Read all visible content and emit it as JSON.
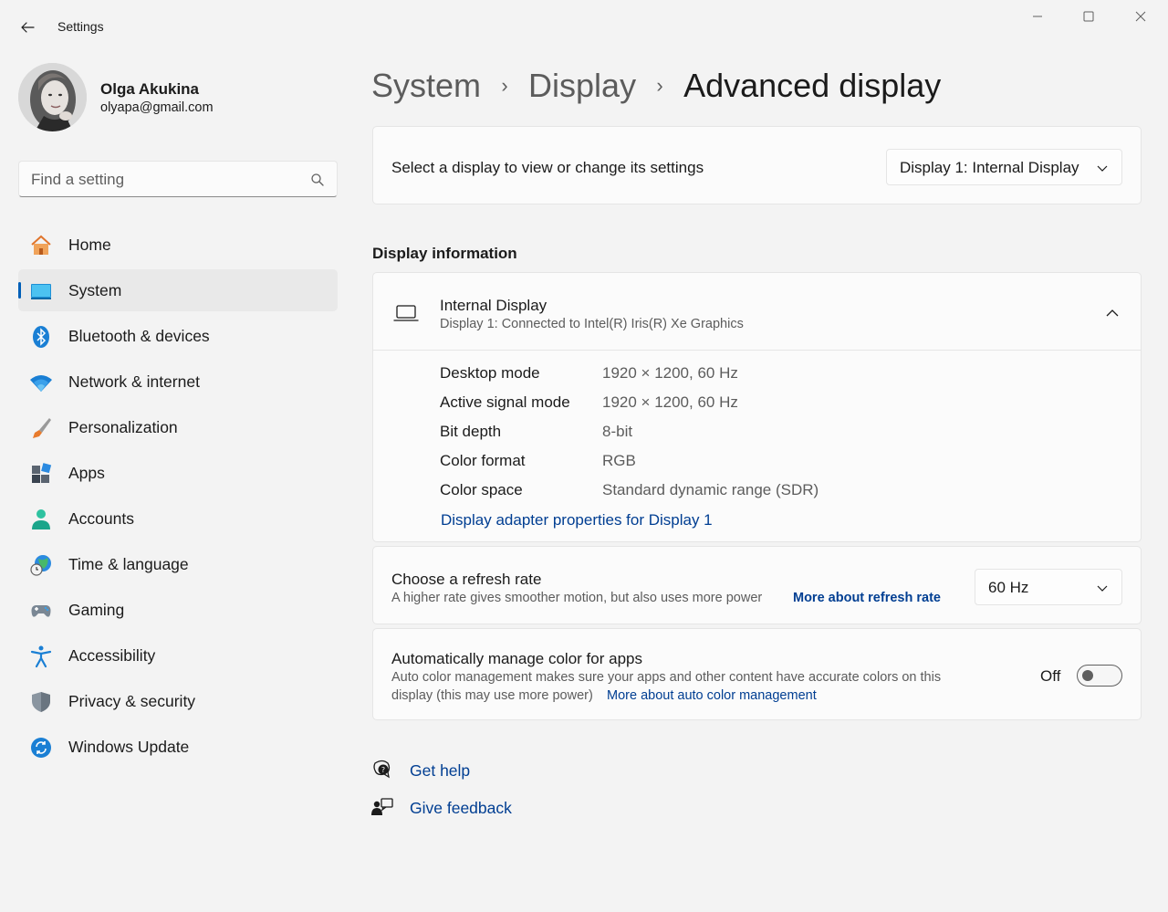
{
  "window": {
    "title": "Settings",
    "back_icon": "back-arrow-icon",
    "controls": [
      "minimize-icon",
      "maximize-icon",
      "close-icon"
    ]
  },
  "profile": {
    "name": "Olga Akukina",
    "email": "olyapa@gmail.com"
  },
  "search": {
    "placeholder": "Find a setting",
    "value": ""
  },
  "sidebar": {
    "items": [
      {
        "label": "Home",
        "icon": "home-icon"
      },
      {
        "label": "System",
        "icon": "system-display-icon",
        "active": true
      },
      {
        "label": "Bluetooth & devices",
        "icon": "bluetooth-icon"
      },
      {
        "label": "Network & internet",
        "icon": "wifi-icon"
      },
      {
        "label": "Personalization",
        "icon": "paintbrush-icon"
      },
      {
        "label": "Apps",
        "icon": "apps-icon"
      },
      {
        "label": "Accounts",
        "icon": "person-icon"
      },
      {
        "label": "Time & language",
        "icon": "globe-clock-icon"
      },
      {
        "label": "Gaming",
        "icon": "gamepad-icon"
      },
      {
        "label": "Accessibility",
        "icon": "accessibility-icon"
      },
      {
        "label": "Privacy & security",
        "icon": "shield-icon"
      },
      {
        "label": "Windows Update",
        "icon": "update-icon"
      }
    ]
  },
  "breadcrumb": {
    "items": [
      "System",
      "Display",
      "Advanced display"
    ],
    "separator": "›"
  },
  "display_select": {
    "label": "Select a display to view or change its settings",
    "selected": "Display 1: Internal Display"
  },
  "display_info": {
    "section_title": "Display information",
    "name": "Internal Display",
    "connection": "Display 1: Connected to Intel(R) Iris(R) Xe Graphics",
    "rows": [
      {
        "key": "Desktop mode",
        "value": "1920 × 1200, 60 Hz"
      },
      {
        "key": "Active signal mode",
        "value": "1920 × 1200, 60 Hz"
      },
      {
        "key": "Bit depth",
        "value": "8-bit"
      },
      {
        "key": "Color format",
        "value": "RGB"
      },
      {
        "key": "Color space",
        "value": "Standard dynamic range (SDR)"
      }
    ],
    "adapter_link": "Display adapter properties for Display 1"
  },
  "refresh_rate": {
    "title": "Choose a refresh rate",
    "description": "A higher rate gives smoother motion, but also uses more power",
    "link": "More about refresh rate",
    "selected": "60 Hz"
  },
  "auto_color": {
    "title": "Automatically manage color for apps",
    "description_line1": "Auto color management makes sure your apps and other content have accurate colors on this",
    "description_line2": "display (this may use more power)",
    "link": "More about auto color management",
    "state_label": "Off",
    "enabled": false
  },
  "help": {
    "get_help": "Get help",
    "give_feedback": "Give feedback"
  },
  "colors": {
    "accent": "#005fb8",
    "link": "#003e92",
    "background": "#f3f3f3",
    "card": "#fbfbfb"
  }
}
